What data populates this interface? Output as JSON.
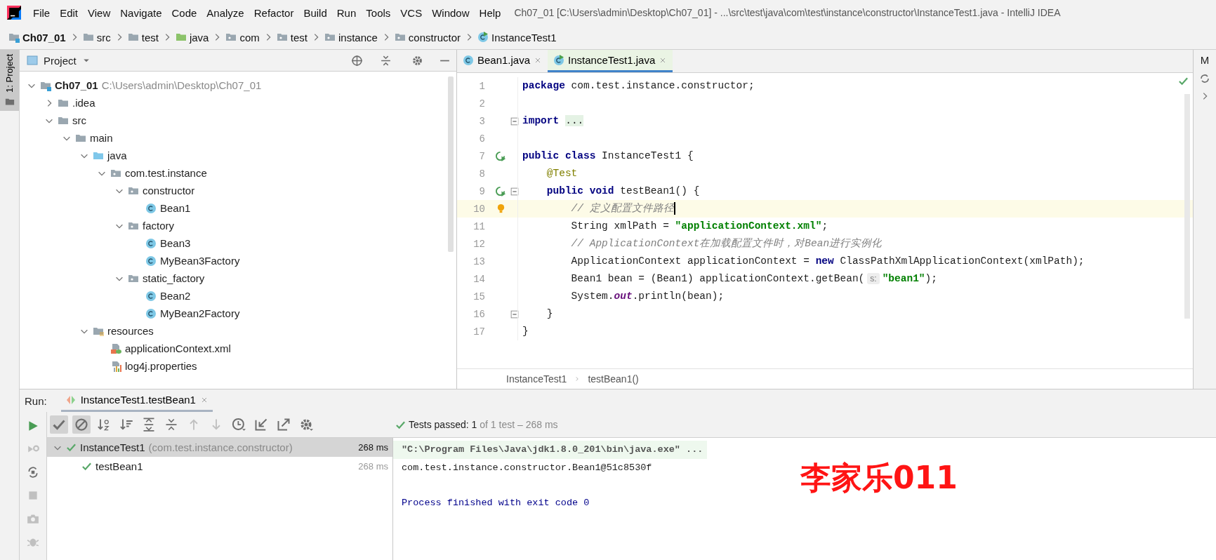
{
  "menu_bar": {
    "items": [
      "File",
      "Edit",
      "View",
      "Navigate",
      "Code",
      "Analyze",
      "Refactor",
      "Build",
      "Run",
      "Tools",
      "VCS",
      "Window",
      "Help"
    ],
    "title": "Ch07_01 [C:\\Users\\admin\\Desktop\\Ch07_01] - ...\\src\\test\\java\\com\\test\\instance\\constructor\\InstanceTest1.java - IntelliJ IDEA"
  },
  "nav_bar": {
    "items": [
      {
        "label": "Ch07_01",
        "kind": "module"
      },
      {
        "label": "src",
        "kind": "folder"
      },
      {
        "label": "test",
        "kind": "folder"
      },
      {
        "label": "java",
        "kind": "test-root"
      },
      {
        "label": "com",
        "kind": "package"
      },
      {
        "label": "test",
        "kind": "package"
      },
      {
        "label": "instance",
        "kind": "package"
      },
      {
        "label": "constructor",
        "kind": "package"
      },
      {
        "label": "InstanceTest1",
        "kind": "test-class"
      }
    ]
  },
  "left_stripe": {
    "tab": "1: Project",
    "selected": true
  },
  "project_panel": {
    "title": "Project",
    "tree": [
      {
        "label": "Ch07_01",
        "path": "C:\\Users\\admin\\Desktop\\Ch07_01",
        "kind": "module",
        "expanded": true,
        "children": [
          {
            "label": ".idea",
            "kind": "folder",
            "expanded": false
          },
          {
            "label": "src",
            "kind": "folder",
            "expanded": true,
            "children": [
              {
                "label": "main",
                "kind": "folder",
                "expanded": true,
                "children": [
                  {
                    "label": "java",
                    "kind": "source-root",
                    "expanded": true,
                    "children": [
                      {
                        "label": "com.test.instance",
                        "kind": "package",
                        "expanded": true,
                        "children": [
                          {
                            "label": "constructor",
                            "kind": "package",
                            "expanded": true,
                            "children": [
                              {
                                "label": "Bean1",
                                "kind": "class"
                              }
                            ]
                          },
                          {
                            "label": "factory",
                            "kind": "package",
                            "expanded": true,
                            "children": [
                              {
                                "label": "Bean3",
                                "kind": "class"
                              },
                              {
                                "label": "MyBean3Factory",
                                "kind": "class"
                              }
                            ]
                          },
                          {
                            "label": "static_factory",
                            "kind": "package",
                            "expanded": true,
                            "children": [
                              {
                                "label": "Bean2",
                                "kind": "class"
                              },
                              {
                                "label": "MyBean2Factory",
                                "kind": "class"
                              }
                            ]
                          }
                        ]
                      }
                    ]
                  },
                  {
                    "label": "resources",
                    "kind": "resources-root",
                    "expanded": true,
                    "children": [
                      {
                        "label": "applicationContext.xml",
                        "kind": "xml"
                      },
                      {
                        "label": "log4j.properties",
                        "kind": "properties"
                      }
                    ]
                  }
                ]
              }
            ]
          }
        ]
      }
    ]
  },
  "editor": {
    "tabs": [
      {
        "label": "Bean1.java",
        "kind": "class",
        "selected": false
      },
      {
        "label": "InstanceTest1.java",
        "kind": "test-class",
        "selected": true
      }
    ],
    "lines": [
      {
        "number": "1",
        "current": false,
        "fold": false,
        "run": false,
        "bulb": false,
        "tokens": [
          {
            "kind": "keyword",
            "text": "package"
          },
          {
            "kind": "plain",
            "text": " com.test.instance.constructor;"
          }
        ]
      },
      {
        "number": "2",
        "current": false,
        "fold": false,
        "run": false,
        "bulb": false
      },
      {
        "number": "3",
        "current": false,
        "fold": true,
        "run": false,
        "bulb": false,
        "tokens": [
          {
            "kind": "keyword",
            "text": "import"
          },
          {
            "kind": "folded",
            "text": "..."
          }
        ]
      },
      {
        "number": "6",
        "current": false,
        "fold": false,
        "run": false,
        "bulb": false
      },
      {
        "number": "7",
        "current": false,
        "fold": false,
        "run": true,
        "bulb": false,
        "tokens": [
          {
            "kind": "keyword",
            "text": "public class"
          },
          {
            "kind": "plain",
            "text": " InstanceTest1 {"
          }
        ]
      },
      {
        "number": "8",
        "current": false,
        "fold": false,
        "run": false,
        "bulb": false,
        "tokens": [
          {
            "kind": "annotation",
            "text": "    @Test"
          }
        ]
      },
      {
        "number": "9",
        "current": false,
        "fold": true,
        "run": true,
        "bulb": false,
        "tokens": [
          {
            "kind": "keyword",
            "text": "    public void"
          },
          {
            "kind": "plain",
            "text": " testBean1() {"
          }
        ]
      },
      {
        "number": "10",
        "current": true,
        "fold": false,
        "run": false,
        "bulb": true,
        "tokens": [
          {
            "kind": "comment",
            "text": "        // 定义配置文件路径"
          }
        ]
      },
      {
        "number": "11",
        "current": false,
        "fold": false,
        "run": false,
        "bulb": false,
        "tokens": [
          {
            "kind": "plain",
            "text": "        String xmlPath = "
          },
          {
            "kind": "string",
            "text": "\"applicationContext.xml\""
          },
          {
            "kind": "plain",
            "text": ";"
          }
        ]
      },
      {
        "number": "12",
        "current": false,
        "fold": false,
        "run": false,
        "bulb": false,
        "tokens": [
          {
            "kind": "comment",
            "text": "        // ApplicationContext在加载配置文件时，对Bean进行实例化"
          }
        ]
      },
      {
        "number": "13",
        "current": false,
        "fold": false,
        "run": false,
        "bulb": false,
        "tokens": [
          {
            "kind": "plain",
            "text": "        ApplicationContext applicationContext = "
          },
          {
            "kind": "keyword",
            "text": "new"
          },
          {
            "kind": "plain",
            "text": " ClassPathXmlApplicationContext(xmlPath);"
          }
        ]
      },
      {
        "number": "14",
        "current": false,
        "fold": false,
        "run": false,
        "bulb": false,
        "tokens": [
          {
            "kind": "plain",
            "text": "        Bean1 bean = (Bean1) applicationContext.getBean("
          },
          {
            "kind": "hint",
            "text": "s:"
          },
          {
            "kind": "string",
            "text": "\"bean1\""
          },
          {
            "kind": "plain",
            "text": ");"
          }
        ]
      },
      {
        "number": "15",
        "current": false,
        "fold": false,
        "run": false,
        "bulb": false,
        "tokens": [
          {
            "kind": "plain",
            "text": "        System."
          },
          {
            "kind": "static",
            "text": "out"
          },
          {
            "kind": "plain",
            "text": ".println(bean);"
          }
        ]
      },
      {
        "number": "16",
        "current": false,
        "fold": true,
        "run": false,
        "bulb": false,
        "tokens": [
          {
            "kind": "plain",
            "text": "    }"
          }
        ]
      },
      {
        "number": "17",
        "current": false,
        "fold": false,
        "run": false,
        "bulb": false,
        "tokens": [
          {
            "kind": "plain",
            "text": "}"
          }
        ]
      }
    ],
    "breadcrumbs": [
      "InstanceTest1",
      "testBean1()"
    ]
  },
  "right_strip": {
    "label": "M"
  },
  "run_panel": {
    "label": "Run:",
    "tab": {
      "label": "InstanceTest1.testBean1",
      "selected": true
    },
    "side_tools": [
      {
        "kind": "rerun",
        "disabled": false
      },
      {
        "kind": "rerun-failed",
        "disabled": true
      },
      {
        "kind": "auto-test",
        "disabled": false
      },
      {
        "kind": "stop",
        "disabled": true
      },
      {
        "kind": "camera",
        "disabled": true
      },
      {
        "kind": "debug",
        "disabled": true
      }
    ],
    "toolbar": [
      {
        "kind": "show-passed",
        "selected": true,
        "disabled": false
      },
      {
        "kind": "show-ignored",
        "selected": true,
        "disabled": false
      },
      {
        "kind": "sort-alpha",
        "selected": false,
        "disabled": false
      },
      {
        "kind": "sort-duration",
        "selected": false,
        "disabled": false
      },
      {
        "kind": "expand-all",
        "selected": false,
        "disabled": false
      },
      {
        "kind": "collapse-all",
        "selected": false,
        "disabled": false
      },
      {
        "kind": "previous",
        "selected": false,
        "disabled": true
      },
      {
        "kind": "next",
        "selected": false,
        "disabled": true
      },
      {
        "kind": "history",
        "selected": false,
        "disabled": false
      },
      {
        "kind": "import",
        "selected": false,
        "disabled": false
      },
      {
        "kind": "export",
        "selected": false,
        "disabled": false
      },
      {
        "kind": "settings",
        "selected": false,
        "disabled": false
      }
    ],
    "status": {
      "passed": "Tests passed: 1",
      "detail": "of 1 test – 268 ms"
    },
    "tests": [
      {
        "label": "InstanceTest1",
        "detail": "(com.test.instance.constructor)",
        "time": "268 ms",
        "selected": true,
        "expanded": true,
        "children": [
          {
            "label": "testBean1",
            "time": "268 ms",
            "selected": false
          }
        ]
      }
    ],
    "console": [
      {
        "kind": "command",
        "text": "\"C:\\Program Files\\Java\\jdk1.8.0_201\\bin\\java.exe\" ..."
      },
      {
        "kind": "output",
        "text": "com.test.instance.constructor.Bean1@51c8530f"
      },
      {
        "kind": "system",
        "text": "Process finished with exit code 0"
      }
    ]
  },
  "annotation": "李家乐011"
}
